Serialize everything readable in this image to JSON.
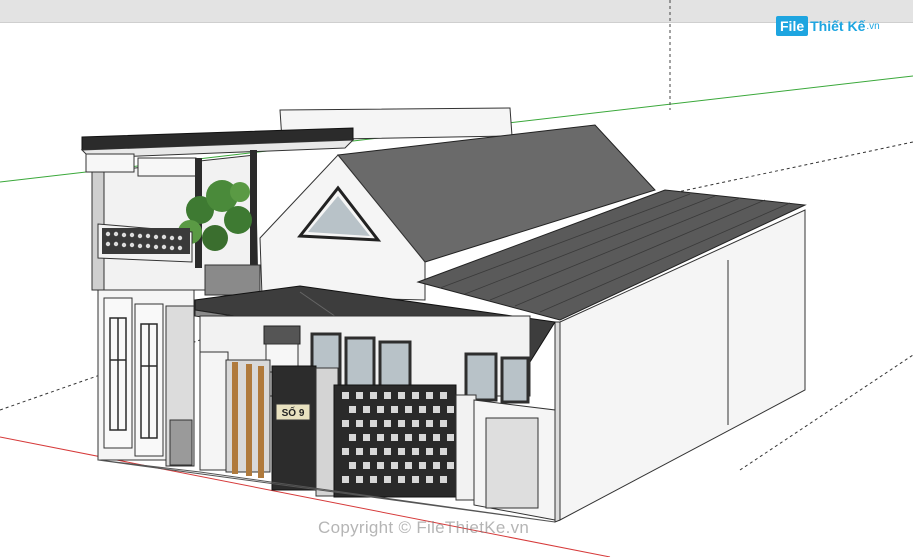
{
  "logo": {
    "mark": "File",
    "name": "Thiết Kế",
    "tld": ".vn"
  },
  "watermark": "Copyright © FileThietKe.vn",
  "door_sign": "SỐ 9",
  "colors": {
    "axis_red": "#d63a3a",
    "axis_green": "#3aa83a",
    "roof_tile": "#5e5e5e",
    "wall": "#f2f2f2",
    "glass": "#b8c2c8",
    "dark_frame": "#2e2e2e",
    "wood": "#b07a3c"
  }
}
